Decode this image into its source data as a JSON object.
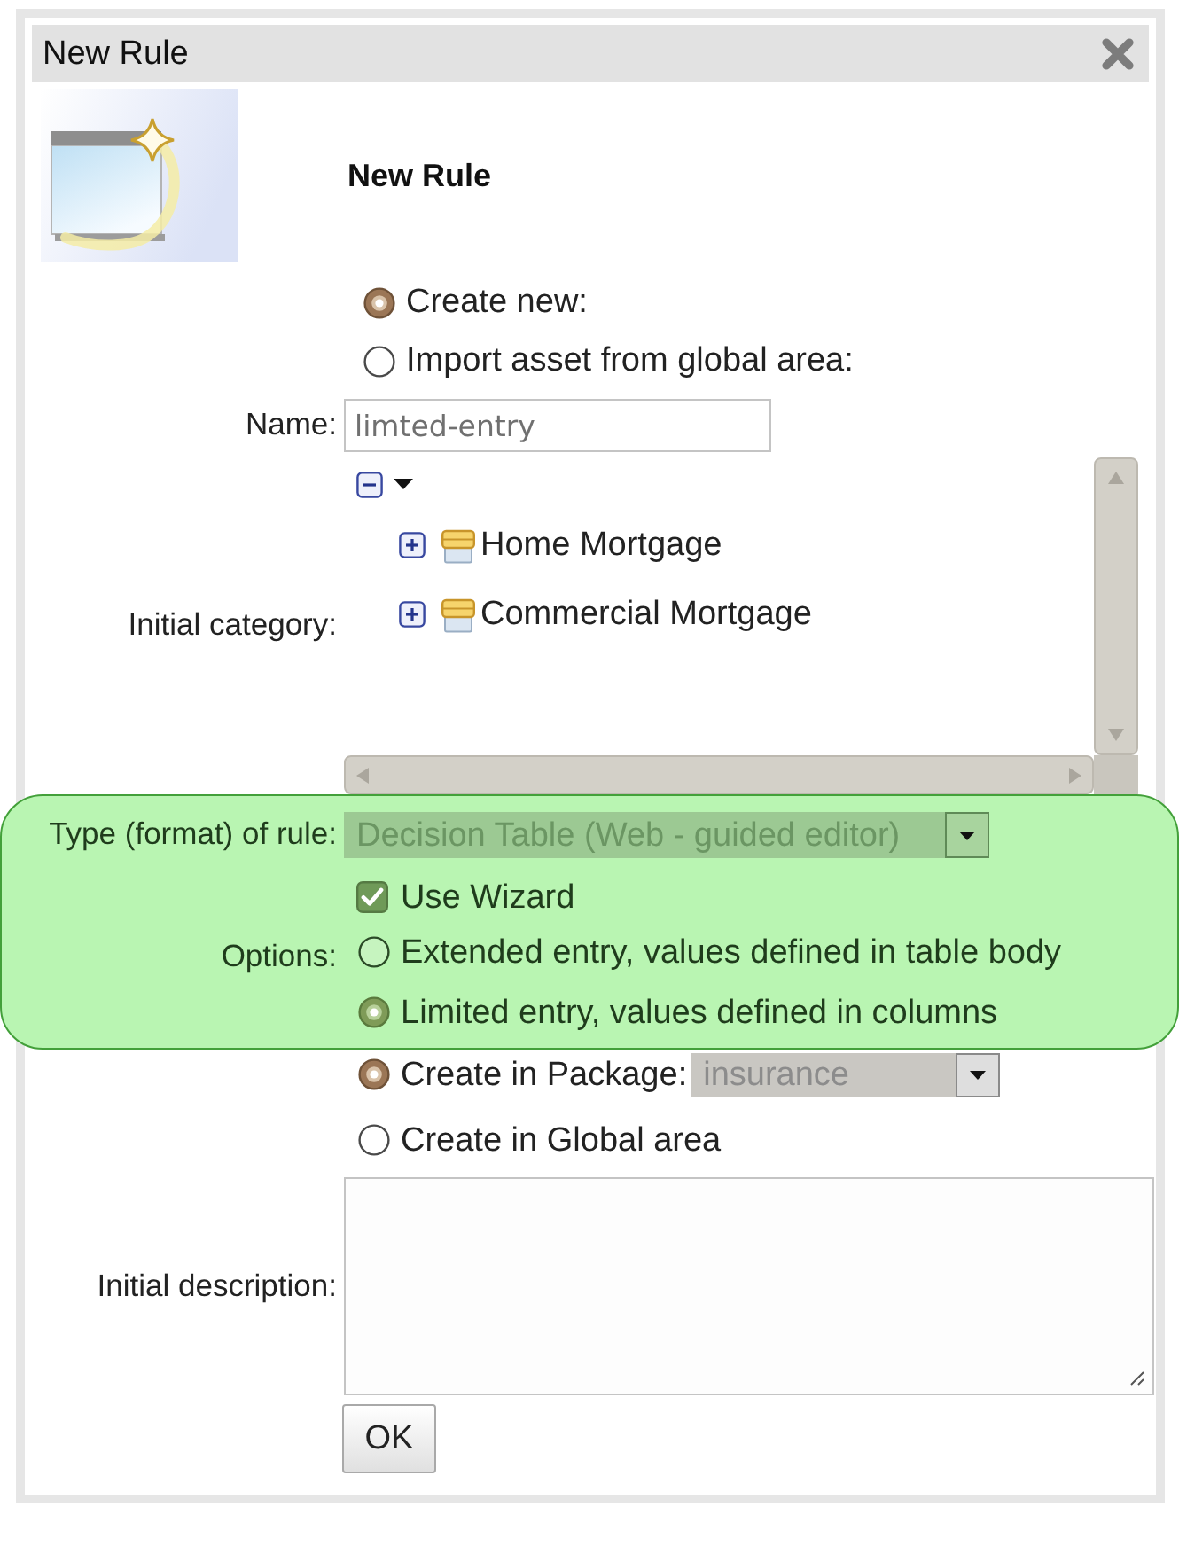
{
  "window": {
    "title": "New Rule"
  },
  "header": {
    "title": "New Rule"
  },
  "create_mode": [
    {
      "label": "Create new:",
      "selected": true
    },
    {
      "label": "Import asset from global area:",
      "selected": false
    }
  ],
  "name": {
    "label": "Name:",
    "value": "limted-entry"
  },
  "category": {
    "label": "Initial category:",
    "tree": {
      "expanded": true,
      "children": [
        {
          "label": "Home Mortgage",
          "expanded": false
        },
        {
          "label": "Commercial Mortgage",
          "expanded": false
        }
      ]
    }
  },
  "rule_settings": {
    "highlighted": true,
    "rule_type": {
      "label": "Type (format) of rule:",
      "value": "Decision Table (Web - guided editor)",
      "disabled": true
    },
    "options": {
      "label": "Options:",
      "use_wizard": {
        "label": "Use Wizard",
        "checked": true
      },
      "entry_types": [
        {
          "label": "Extended entry, values defined in table body",
          "selected": false
        },
        {
          "label": "Limited entry, values defined in columns",
          "selected": true
        }
      ]
    }
  },
  "location": [
    {
      "label": "Create in Package:",
      "selected": true,
      "package": {
        "value": "insurance",
        "disabled": true
      }
    },
    {
      "label": "Create in Global area",
      "selected": false
    }
  ],
  "description": {
    "label": "Initial description:"
  },
  "buttons": [
    {
      "label": "OK"
    }
  ]
}
